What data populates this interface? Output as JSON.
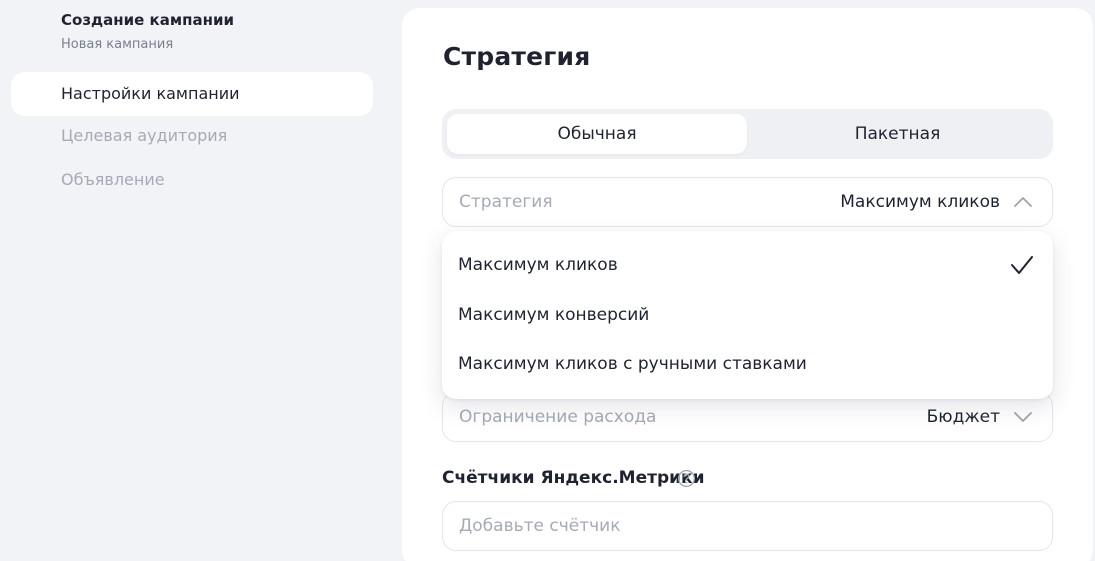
{
  "sidebar": {
    "title": "Создание кампании",
    "subtitle": "Новая кампания",
    "items": [
      {
        "label": "Настройки кампании",
        "active": true
      },
      {
        "label": "Целевая аудитория",
        "active": false
      },
      {
        "label": "Объявление",
        "active": false
      }
    ]
  },
  "main": {
    "title": "Стратегия",
    "segments": {
      "left": "Обычная",
      "right": "Пакетная",
      "selected": "Обычная"
    },
    "strategy_field": {
      "label": "Стратегия",
      "value": "Максимум кликов",
      "icon": "chevron-up-icon"
    },
    "strategy_options": [
      {
        "label": "Максимум кликов",
        "selected": true
      },
      {
        "label": "Максимум конверсий",
        "selected": false
      },
      {
        "label": "Максимум кликов с ручными ставками",
        "selected": false
      }
    ],
    "spend_field": {
      "label": "Ограничение расхода",
      "value": "Бюджет",
      "icon": "chevron-down-icon"
    },
    "metrika": {
      "title": "Счётчики Яндекс.Метрики",
      "help_icon": "question-circle-icon",
      "placeholder": "Добавьте счётчик"
    }
  },
  "colors": {
    "background": "#f2f3f6",
    "card": "#ffffff",
    "text": "#1f2330",
    "muted": "#a5aab6"
  }
}
